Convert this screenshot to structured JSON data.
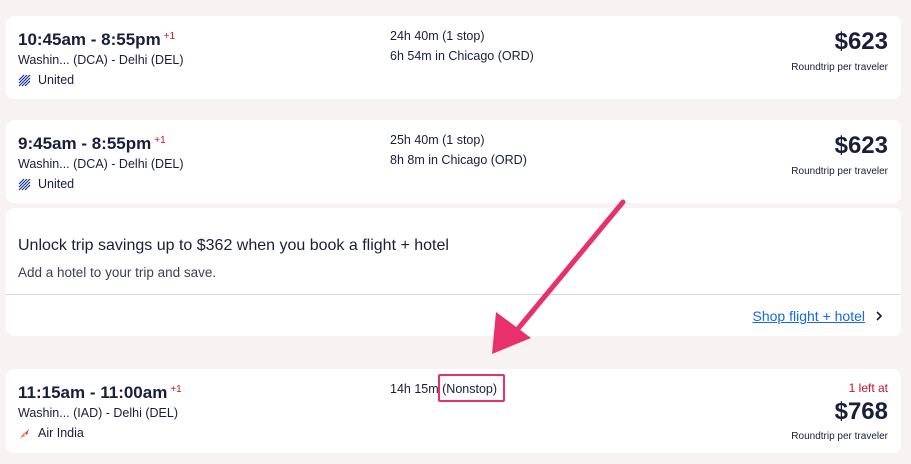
{
  "flights": [
    {
      "times": "10:45am - 8:55pm",
      "plus_day": "+1",
      "route": "Washin... (DCA) - Delhi (DEL)",
      "airline": "United",
      "airline_icon": "united-logo-icon",
      "duration": "24h 40m (1 stop)",
      "stop_detail": "6h 54m in Chicago (ORD)",
      "price": "$623",
      "price_note": "Roundtrip per traveler"
    },
    {
      "times": "9:45am - 8:55pm",
      "plus_day": "+1",
      "route": "Washin... (DCA) - Delhi (DEL)",
      "airline": "United",
      "airline_icon": "united-logo-icon",
      "duration": "25h 40m (1 stop)",
      "stop_detail": "8h 8m in Chicago (ORD)",
      "price": "$623",
      "price_note": "Roundtrip per traveler"
    },
    {
      "times": "11:15am - 11:00am",
      "plus_day": "+1",
      "route": "Washin... (IAD) - Delhi (DEL)",
      "airline": "Air India",
      "airline_icon": "air-india-logo-icon",
      "duration": "14h 15m",
      "nonstop": "(Nonstop)",
      "seats_left": "1 left at",
      "price": "$768",
      "price_note": "Roundtrip per traveler"
    }
  ],
  "promo": {
    "title": "Unlock trip savings up to $362 when you book a flight + hotel",
    "subtitle": "Add a hotel to your trip and save.",
    "link": "Shop flight + hotel"
  },
  "colors": {
    "background": "#f6f3f2",
    "text": "#191e3b",
    "link": "#1668e3",
    "alert_red": "#c8102e",
    "annotation_pink": "#e8306d"
  }
}
